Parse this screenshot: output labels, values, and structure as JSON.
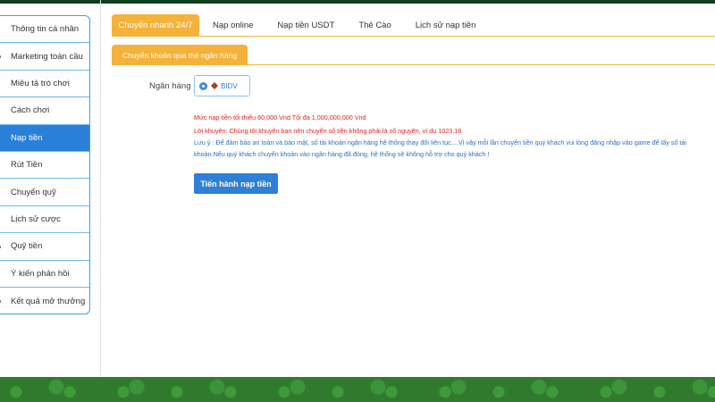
{
  "sidebar": {
    "items": [
      {
        "label": "Thông tin cá nhân",
        "active": false,
        "dot": false
      },
      {
        "label": "Marketing toàn cầu",
        "active": false,
        "dot": true
      },
      {
        "label": "Miêu tả trò chơi",
        "active": false,
        "dot": false
      },
      {
        "label": "Cách chơi",
        "active": false,
        "dot": false
      },
      {
        "label": "Nạp tiền",
        "active": true,
        "dot": false
      },
      {
        "label": "Rút Tiền",
        "active": false,
        "dot": false
      },
      {
        "label": "Chuyển quỹ",
        "active": false,
        "dot": false
      },
      {
        "label": "Lịch sử cược",
        "active": false,
        "dot": false
      },
      {
        "label": "Quỹ tiền",
        "active": false,
        "dot": true
      },
      {
        "label": "Ý kiến phản hồi",
        "active": false,
        "dot": false
      },
      {
        "label": "Kết quả mở thưởng",
        "active": false,
        "dot": true
      }
    ]
  },
  "tabs": [
    {
      "label": "Chuyển nhanh 24/7",
      "active": true
    },
    {
      "label": "Nạp online",
      "active": false
    },
    {
      "label": "Nạp tiền USDT",
      "active": false
    },
    {
      "label": "Thẻ Cào",
      "active": false
    },
    {
      "label": "Lịch sử nạp tiền",
      "active": false
    }
  ],
  "subtab": {
    "label": "Chuyển khoản qua thẻ ngân hàng"
  },
  "bank": {
    "label": "Ngân hàng",
    "selected": "BIDV"
  },
  "notices": {
    "min_max": "Mức nạp tiền tối thiểu 60,000 Vnd Tối đa 1,000,000,000 Vnd",
    "advice": "Lời khuyên: Chúng tôi khuyến bạn nên chuyển số tiền không phải là số nguyên, ví dụ 1023.18",
    "note_line1": "Lưu ý : Để đảm bảo an toàn và bảo mật, số tài khoản ngân hàng hệ thống thay đổi liên tục....Vì vậy mỗi lần chuyển tiền quý khách vui lòng đăng nhập vào game để lấy số tài",
    "note_line2": "khoản.Nếu quý khách chuyển khoản vào ngân hàng đã đóng, hệ thống sẽ không hỗ trợ cho quý khách !"
  },
  "submit": {
    "label": "Tiến hành nạp tiền"
  },
  "colors": {
    "accent_orange": "#f5b23a",
    "accent_blue": "#2a7fd8",
    "notice_red": "#e02020",
    "notice_blue": "#2a6fc9",
    "footer_green": "#2f7a2d"
  }
}
